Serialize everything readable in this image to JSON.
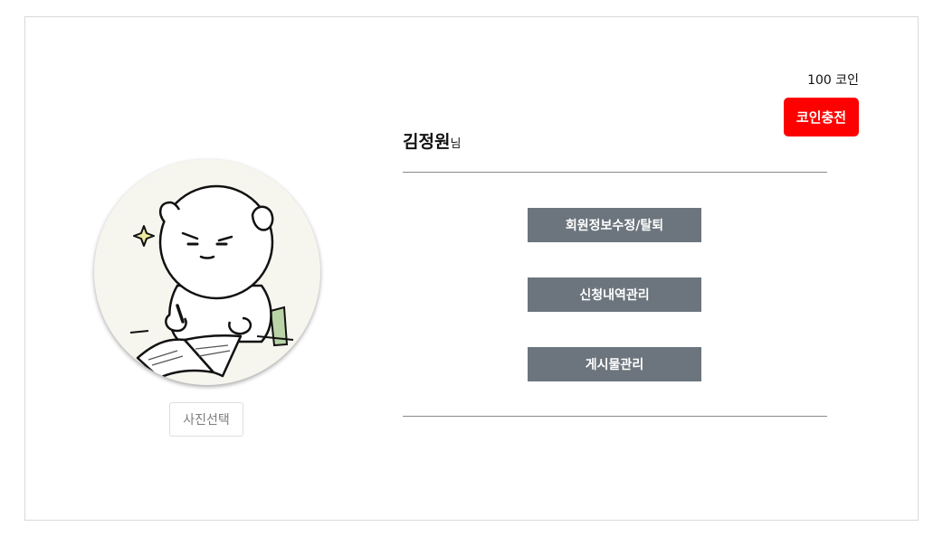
{
  "profile": {
    "name": "김정원",
    "name_suffix": "님",
    "photo_select_label": "사진선택",
    "avatar_icon": "cartoon-character-writing-icon"
  },
  "coins": {
    "count_text": "100 코인",
    "charge_label": "코인충전",
    "charge_color": "#ff0000"
  },
  "menu": {
    "items": [
      {
        "label": "회원정보수정/탈퇴"
      },
      {
        "label": "신청내역관리"
      },
      {
        "label": "게시물관리"
      }
    ],
    "button_color": "#6c757d"
  }
}
